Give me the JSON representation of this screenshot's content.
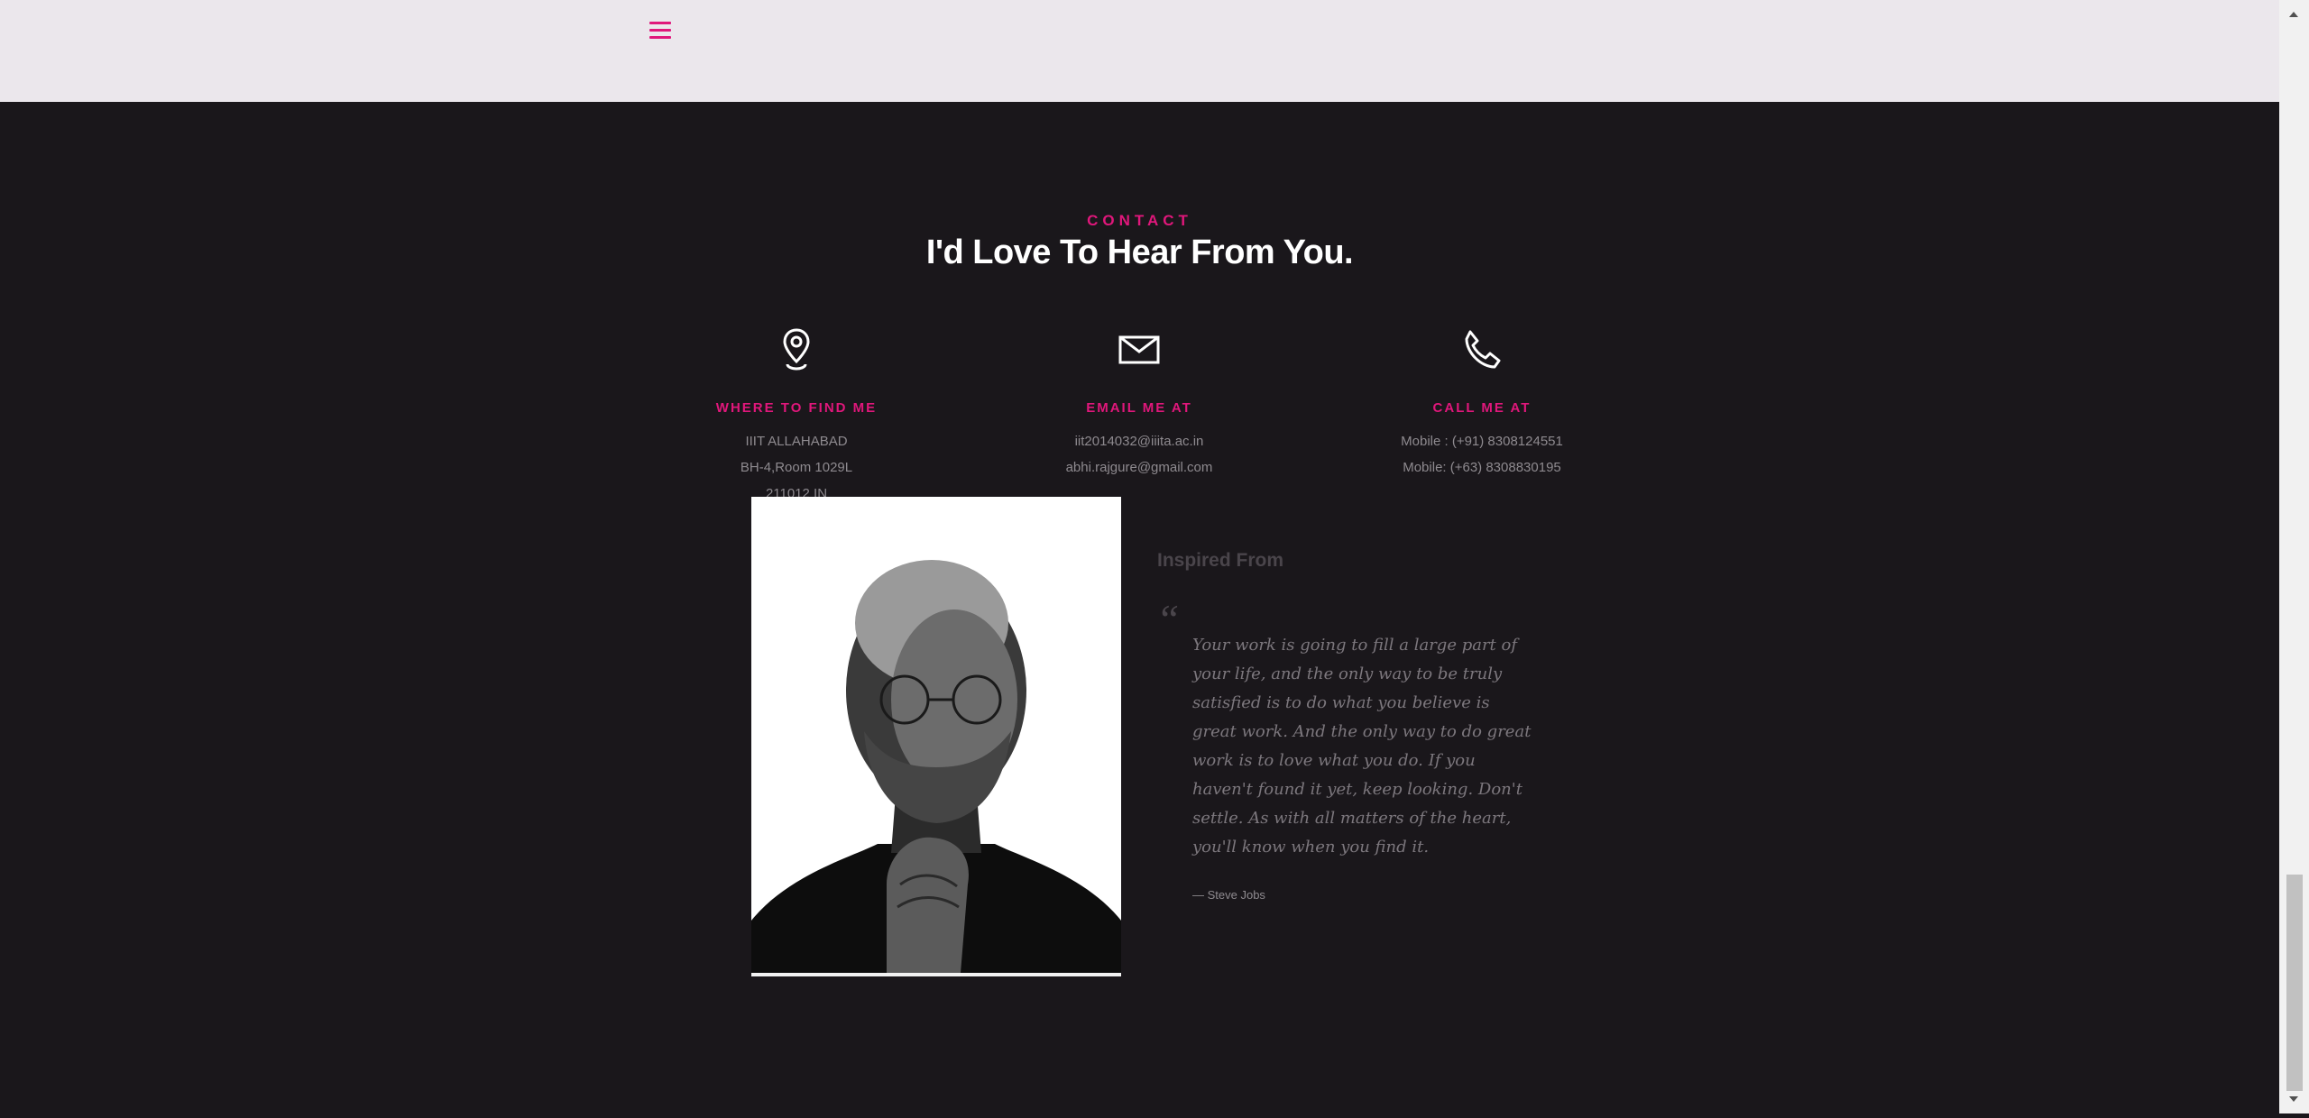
{
  "header": {
    "menu_icon": "hamburger-menu-icon"
  },
  "contact": {
    "eyebrow": "CONTACT",
    "heading": "I'd Love To Hear From You.",
    "columns": [
      {
        "icon": "map-pin-icon",
        "label": "WHERE TO FIND ME",
        "lines": [
          "IIIT ALLAHABAD",
          "BH-4,Room 1029L",
          "211012 IN"
        ]
      },
      {
        "icon": "envelope-icon",
        "label": "EMAIL ME AT",
        "lines": [
          "iit2014032@iiita.ac.in",
          "abhi.rajgure@gmail.com"
        ]
      },
      {
        "icon": "phone-icon",
        "label": "CALL ME AT",
        "lines": [
          "Mobile : (+91) 8308124551",
          "Mobile: (+63) 8308830195"
        ]
      }
    ]
  },
  "inspiration": {
    "title": "Inspired From",
    "quote": "Your work is going to fill a large part of your life, and the only way to be truly satisfied is to do what you believe is great work. And the only way to do great work is to love what you do. If you haven't found it yet, keep looking. Don't settle. As with all matters of the heart, you'll know when you find it.",
    "author": "— Steve Jobs"
  },
  "colors": {
    "accent": "#e0177b",
    "background": "#1a171b",
    "header_bg": "#ebe7ec"
  }
}
